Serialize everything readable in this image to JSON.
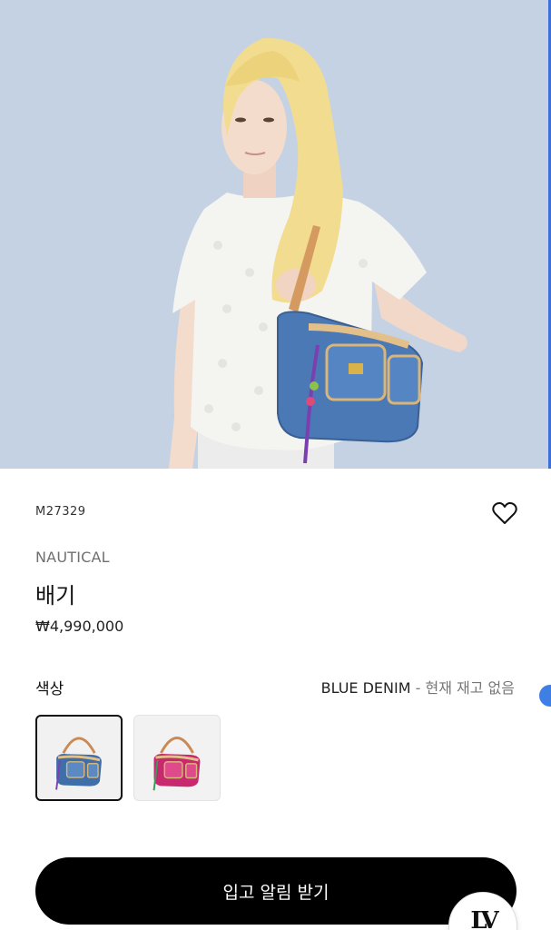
{
  "product": {
    "sku": "M27329",
    "collection": "NAUTICAL",
    "name": "배기",
    "price": "₩4,990,000",
    "wishlist_icon": "heart-outline-icon"
  },
  "color": {
    "label": "색상",
    "selected_name": "BLUE DENIM",
    "separator": "-",
    "stock_status": "현재 재고 없음",
    "swatches": [
      {
        "name": "blue-denim",
        "body": "#3f6fa8",
        "selected": true
      },
      {
        "name": "pink",
        "body": "#c8286e",
        "selected": false
      }
    ]
  },
  "cta": {
    "label": "입고 알림 받기"
  },
  "badge": {
    "logo": "LV"
  },
  "colors": {
    "hero_bg": "#c5d2e4",
    "cta_bg": "#000000",
    "accent_blue": "#3e7fe6"
  }
}
